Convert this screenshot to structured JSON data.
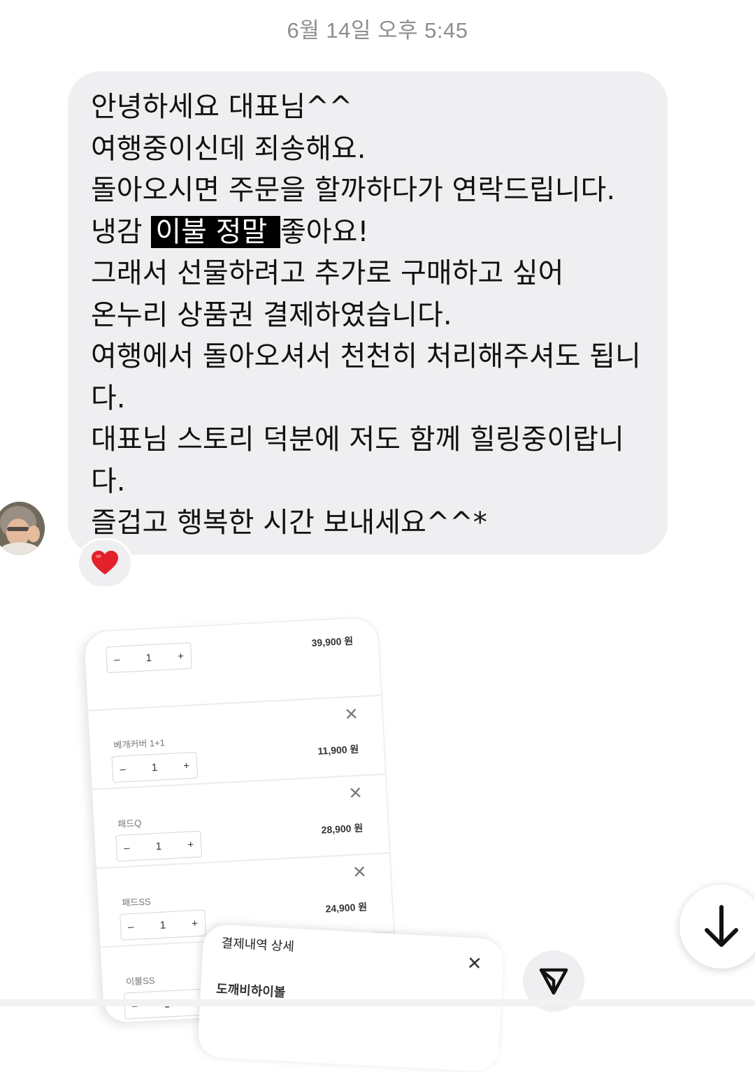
{
  "timestamp": "6월 14일 오후 5:45",
  "message": {
    "lines": [
      "안녕하세요 대표님^^",
      "여행중이신데 죄송해요.",
      "돌아오시면 주문을 할까하다가 연락드립니다.",
      "냉감 ",
      "이불 정말 ",
      "좋아요!",
      "그래서 선물하려고 추가로 구매하고 싶어",
      "온누리 상품권 결제하였습니다.",
      "여행에서 돌아오셔서 천천히 처리해주셔도 됩니다.",
      "대표님 스토리 덕분에 저도 함께 힐링중이랍니다.",
      "즐겁고 행복한 시간 보내세요^^*"
    ],
    "reaction": "❤️"
  },
  "shared_image": {
    "items": [
      {
        "name": "",
        "qty": "1",
        "price": "39,900 원"
      },
      {
        "name": "베개커버 1+1",
        "qty": "1",
        "price": "11,900 원"
      },
      {
        "name": "패드Q",
        "qty": "1",
        "price": "28,900 원"
      },
      {
        "name": "패드SS",
        "qty": "1",
        "price": "24,900 원"
      },
      {
        "name": "이불SS",
        "qty": "1",
        "price": ""
      }
    ],
    "minus": "–",
    "plus": "+",
    "close": "✕"
  },
  "popup_card": {
    "title": "결제내역 상세",
    "subtitle": "도깨비하이볼",
    "close": "✕"
  },
  "colors": {
    "bubble_bg": "#efeff1",
    "timestamp": "#8e8e8e",
    "highlight_bg": "#000000"
  },
  "icons": {
    "scroll_down": "arrow-down-icon",
    "send": "send-icon",
    "reaction": "heart-icon"
  }
}
